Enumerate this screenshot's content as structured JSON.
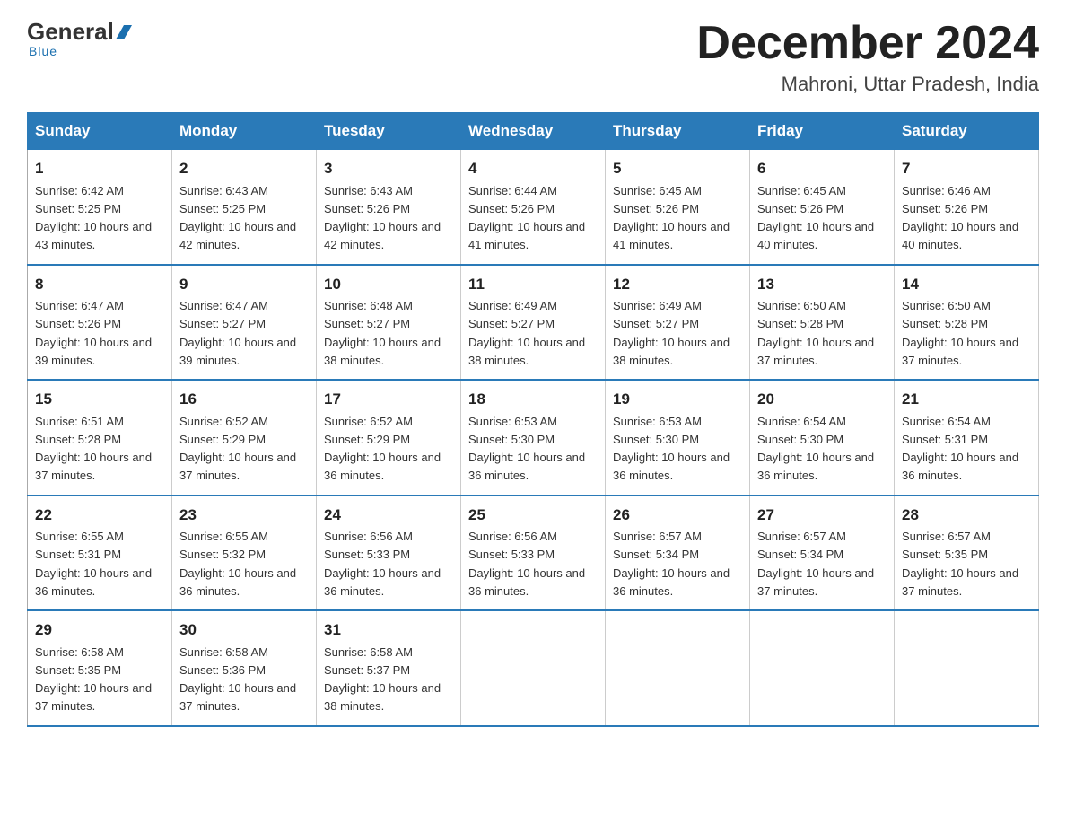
{
  "logo": {
    "general": "General",
    "blue": "Blue",
    "underline": "Blue"
  },
  "header": {
    "month": "December 2024",
    "location": "Mahroni, Uttar Pradesh, India"
  },
  "days_of_week": [
    "Sunday",
    "Monday",
    "Tuesday",
    "Wednesday",
    "Thursday",
    "Friday",
    "Saturday"
  ],
  "weeks": [
    [
      {
        "num": "1",
        "sunrise": "6:42 AM",
        "sunset": "5:25 PM",
        "daylight": "10 hours and 43 minutes."
      },
      {
        "num": "2",
        "sunrise": "6:43 AM",
        "sunset": "5:25 PM",
        "daylight": "10 hours and 42 minutes."
      },
      {
        "num": "3",
        "sunrise": "6:43 AM",
        "sunset": "5:26 PM",
        "daylight": "10 hours and 42 minutes."
      },
      {
        "num": "4",
        "sunrise": "6:44 AM",
        "sunset": "5:26 PM",
        "daylight": "10 hours and 41 minutes."
      },
      {
        "num": "5",
        "sunrise": "6:45 AM",
        "sunset": "5:26 PM",
        "daylight": "10 hours and 41 minutes."
      },
      {
        "num": "6",
        "sunrise": "6:45 AM",
        "sunset": "5:26 PM",
        "daylight": "10 hours and 40 minutes."
      },
      {
        "num": "7",
        "sunrise": "6:46 AM",
        "sunset": "5:26 PM",
        "daylight": "10 hours and 40 minutes."
      }
    ],
    [
      {
        "num": "8",
        "sunrise": "6:47 AM",
        "sunset": "5:26 PM",
        "daylight": "10 hours and 39 minutes."
      },
      {
        "num": "9",
        "sunrise": "6:47 AM",
        "sunset": "5:27 PM",
        "daylight": "10 hours and 39 minutes."
      },
      {
        "num": "10",
        "sunrise": "6:48 AM",
        "sunset": "5:27 PM",
        "daylight": "10 hours and 38 minutes."
      },
      {
        "num": "11",
        "sunrise": "6:49 AM",
        "sunset": "5:27 PM",
        "daylight": "10 hours and 38 minutes."
      },
      {
        "num": "12",
        "sunrise": "6:49 AM",
        "sunset": "5:27 PM",
        "daylight": "10 hours and 38 minutes."
      },
      {
        "num": "13",
        "sunrise": "6:50 AM",
        "sunset": "5:28 PM",
        "daylight": "10 hours and 37 minutes."
      },
      {
        "num": "14",
        "sunrise": "6:50 AM",
        "sunset": "5:28 PM",
        "daylight": "10 hours and 37 minutes."
      }
    ],
    [
      {
        "num": "15",
        "sunrise": "6:51 AM",
        "sunset": "5:28 PM",
        "daylight": "10 hours and 37 minutes."
      },
      {
        "num": "16",
        "sunrise": "6:52 AM",
        "sunset": "5:29 PM",
        "daylight": "10 hours and 37 minutes."
      },
      {
        "num": "17",
        "sunrise": "6:52 AM",
        "sunset": "5:29 PM",
        "daylight": "10 hours and 36 minutes."
      },
      {
        "num": "18",
        "sunrise": "6:53 AM",
        "sunset": "5:30 PM",
        "daylight": "10 hours and 36 minutes."
      },
      {
        "num": "19",
        "sunrise": "6:53 AM",
        "sunset": "5:30 PM",
        "daylight": "10 hours and 36 minutes."
      },
      {
        "num": "20",
        "sunrise": "6:54 AM",
        "sunset": "5:30 PM",
        "daylight": "10 hours and 36 minutes."
      },
      {
        "num": "21",
        "sunrise": "6:54 AM",
        "sunset": "5:31 PM",
        "daylight": "10 hours and 36 minutes."
      }
    ],
    [
      {
        "num": "22",
        "sunrise": "6:55 AM",
        "sunset": "5:31 PM",
        "daylight": "10 hours and 36 minutes."
      },
      {
        "num": "23",
        "sunrise": "6:55 AM",
        "sunset": "5:32 PM",
        "daylight": "10 hours and 36 minutes."
      },
      {
        "num": "24",
        "sunrise": "6:56 AM",
        "sunset": "5:33 PM",
        "daylight": "10 hours and 36 minutes."
      },
      {
        "num": "25",
        "sunrise": "6:56 AM",
        "sunset": "5:33 PM",
        "daylight": "10 hours and 36 minutes."
      },
      {
        "num": "26",
        "sunrise": "6:57 AM",
        "sunset": "5:34 PM",
        "daylight": "10 hours and 36 minutes."
      },
      {
        "num": "27",
        "sunrise": "6:57 AM",
        "sunset": "5:34 PM",
        "daylight": "10 hours and 37 minutes."
      },
      {
        "num": "28",
        "sunrise": "6:57 AM",
        "sunset": "5:35 PM",
        "daylight": "10 hours and 37 minutes."
      }
    ],
    [
      {
        "num": "29",
        "sunrise": "6:58 AM",
        "sunset": "5:35 PM",
        "daylight": "10 hours and 37 minutes."
      },
      {
        "num": "30",
        "sunrise": "6:58 AM",
        "sunset": "5:36 PM",
        "daylight": "10 hours and 37 minutes."
      },
      {
        "num": "31",
        "sunrise": "6:58 AM",
        "sunset": "5:37 PM",
        "daylight": "10 hours and 38 minutes."
      },
      null,
      null,
      null,
      null
    ]
  ]
}
